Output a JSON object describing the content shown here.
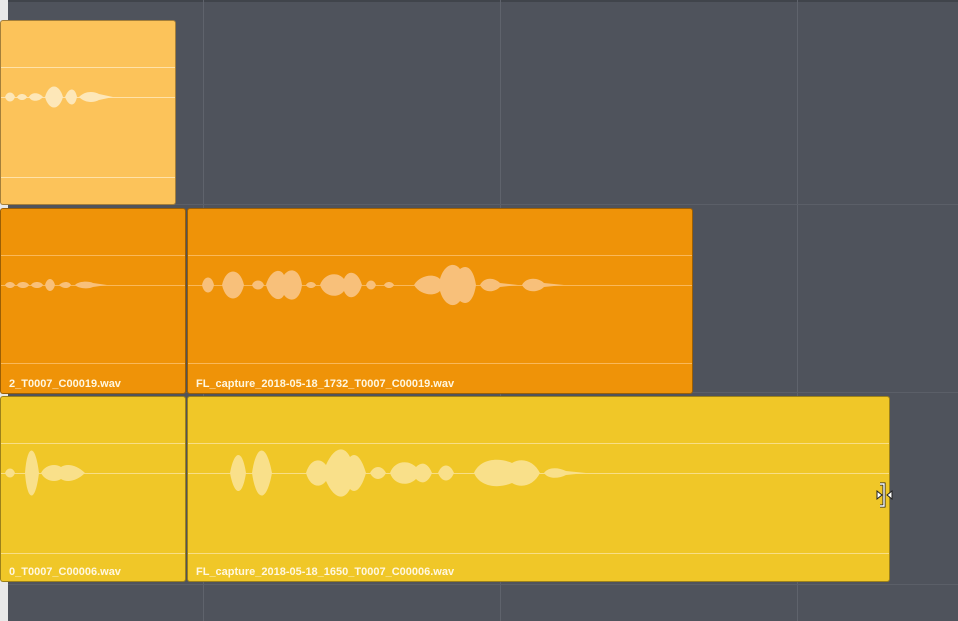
{
  "timeline": {
    "clips": [
      {
        "name": "",
        "color": "#fcc35a"
      },
      {
        "name": "2_T0007_C00019.wav",
        "color": "#ef9308"
      },
      {
        "name": "FL_capture_2018-05-18_1732_T0007_C00019.wav",
        "color": "#ef9308"
      },
      {
        "name": "0_T0007_C00006.wav",
        "color": "#f0c728"
      },
      {
        "name": "FL_capture_2018-05-18_1650_T0007_C00006.wav",
        "color": "#f0c728"
      }
    ],
    "cursor": "trim-cursor-icon"
  }
}
